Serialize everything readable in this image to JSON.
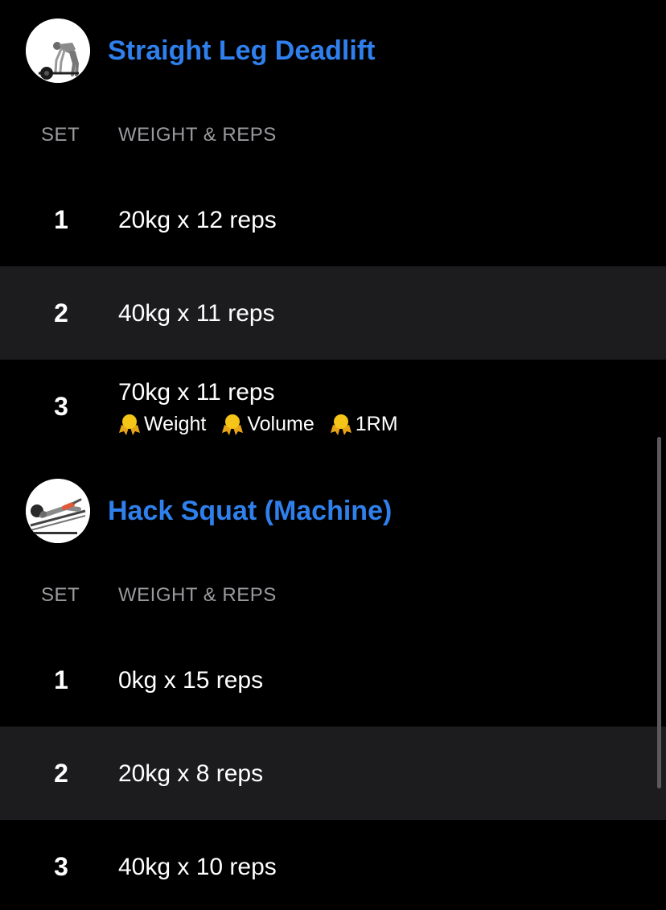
{
  "theme": {
    "background": "#000000",
    "row_alt": "#1c1c1e",
    "accent": "#2f80ed",
    "muted": "#9a9a9f",
    "medal": "#f5c518"
  },
  "exercises": [
    {
      "name": "Straight Leg Deadlift",
      "thumbnail_icon": "deadlift-illustration",
      "column_set": "SET",
      "column_weight_reps": "WEIGHT & REPS",
      "sets": [
        {
          "number": "1",
          "value": "20kg x 12 reps"
        },
        {
          "number": "2",
          "value": "40kg x 11 reps"
        },
        {
          "number": "3",
          "value": "70kg x 11 reps",
          "records": [
            {
              "icon": "medal-icon",
              "label": "Weight"
            },
            {
              "icon": "medal-icon",
              "label": "Volume"
            },
            {
              "icon": "medal-icon",
              "label": "1RM"
            }
          ]
        }
      ]
    },
    {
      "name": "Hack Squat (Machine)",
      "thumbnail_icon": "hack-squat-illustration",
      "column_set": "SET",
      "column_weight_reps": "WEIGHT & REPS",
      "sets": [
        {
          "number": "1",
          "value": "0kg x 15 reps"
        },
        {
          "number": "2",
          "value": "20kg x 8 reps"
        },
        {
          "number": "3",
          "value": "40kg x 10 reps"
        }
      ]
    }
  ]
}
